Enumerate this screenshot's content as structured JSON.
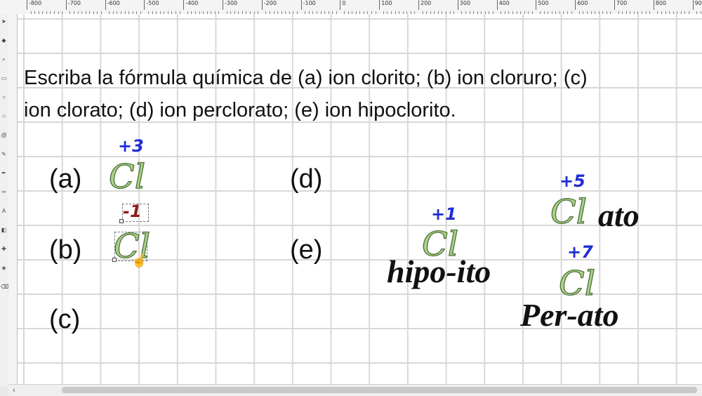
{
  "ruler": {
    "labels": [
      "-800",
      "-700",
      "-600",
      "-500",
      "-400",
      "-300",
      "-200",
      "-100",
      "0",
      "100",
      "200",
      "300",
      "400",
      "500",
      "600",
      "700",
      "800",
      "900"
    ]
  },
  "question": {
    "line1": "Escriba la fórmula química de (a) ion clorito; (b) ion cloruro; (c)",
    "line2": "ion clorato; (d) ion perclorato; (e) ion hipoclorito."
  },
  "labels": {
    "a": "(a)",
    "b": "(b)",
    "c": "(c)",
    "d": "(d)",
    "e": "(e)"
  },
  "symbol": "Cl",
  "oxidation": {
    "a": "+3",
    "b": "-1",
    "hipo": "+1",
    "ato": "+5",
    "per": "+7"
  },
  "words": {
    "hipo": "hipo-ito",
    "ato": "ato",
    "per": "Per-ato"
  },
  "colors": {
    "chlorine_fill": "#aad488",
    "positive_state": "#1f2ed6",
    "negative_state": "#8e1c1c",
    "grid": "#d8d8d8"
  },
  "icons": [
    "selector-icon",
    "node-icon",
    "zoom-icon",
    "rectangle-icon",
    "ellipse-icon",
    "star-icon",
    "spiral-icon",
    "pencil-icon",
    "pen-icon",
    "calligraphy-icon",
    "text-icon",
    "gradient-icon",
    "dropper-icon",
    "paint-bucket-icon",
    "eraser-icon"
  ]
}
